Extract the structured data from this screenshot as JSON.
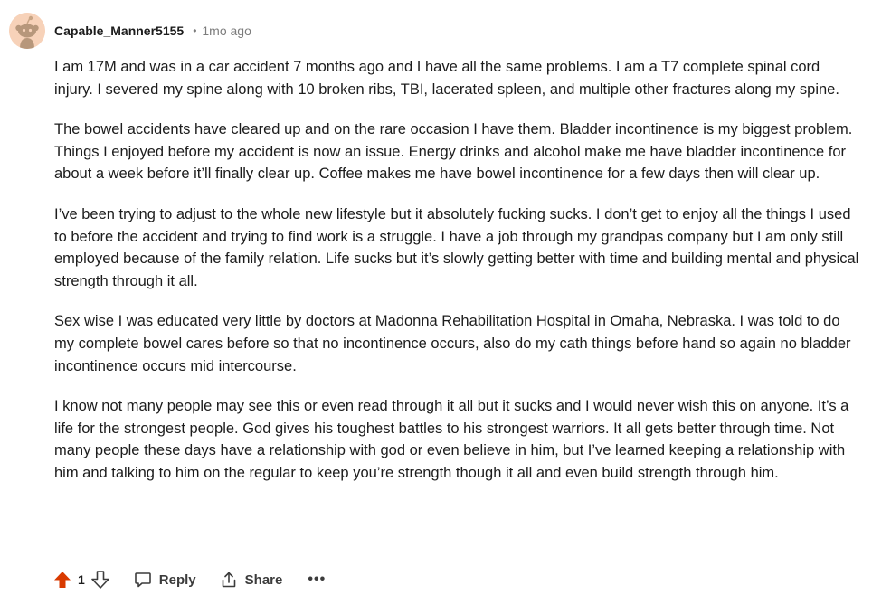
{
  "comment": {
    "username": "Capable_Manner5155",
    "separator": "•",
    "time": "1mo ago",
    "paragraphs": [
      "I am 17M and was in a car accident 7 months ago and I have all the same problems. I am a T7 complete spinal cord injury. I severed my spine along with 10 broken ribs, TBI, lacerated spleen, and multiple other fractures along my spine.",
      "The bowel accidents have cleared up and on the rare occasion I have them. Bladder incontinence is my biggest problem. Things I enjoyed before my accident is now an issue. Energy drinks and alcohol make me have bladder incontinence for about a week before it’ll finally clear up. Coffee makes me have bowel incontinence for a few days then will clear up.",
      "I’ve been trying to adjust to the whole new lifestyle but it absolutely fucking sucks. I don’t get to enjoy all the things I used to before the accident and trying to find work is a struggle. I have a job through my grandpas company but I am only still employed because of the family relation. Life sucks but it’s slowly getting better with time and building mental and physical strength through it all.",
      "Sex wise I was educated very little by doctors at Madonna Rehabilitation Hospital in Omaha, Nebraska. I was told to do my complete bowel cares before so that no incontinence occurs, also do my cath things before hand so again no bladder incontinence occurs mid intercourse.",
      "I know not many people may see this or even read through it all but it sucks and I would never wish this on anyone. It’s a life for the strongest people. God gives his toughest battles to his strongest warriors. It all gets better through time. Not many people these days have a relationship with god or even believe in him, but I’ve learned keeping a relationship with him and talking to him on the regular to keep you’re strength though it all and even build strength through him."
    ]
  },
  "actions": {
    "vote_count": "1",
    "reply_label": "Reply",
    "share_label": "Share",
    "more_label": "•••"
  },
  "icons": {
    "avatar": "snoo-avatar-icon",
    "upvote": "upvote-arrow-icon",
    "downvote": "downvote-arrow-icon",
    "reply": "comment-bubble-icon",
    "share": "share-icon"
  },
  "colors": {
    "upvote_active": "#d93a00",
    "text": "#1c1c1c",
    "meta": "#7c7c7c",
    "avatar_bg": "#f7d2b9"
  }
}
